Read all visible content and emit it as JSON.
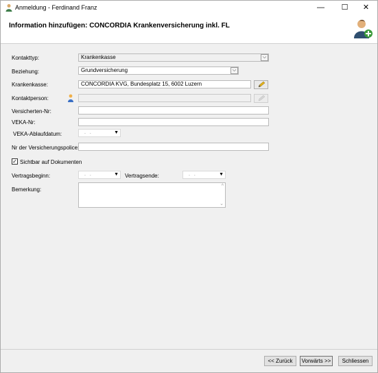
{
  "window": {
    "title": "Anmeldung - Ferdinand Franz",
    "minimize": "—",
    "maximize": "☐",
    "close": "✕"
  },
  "header": {
    "title": "Information hinzufügen: CONCORDIA Krankenversicherung inkl. FL"
  },
  "form": {
    "kontakttyp_label": "Kontakttyp:",
    "kontakttyp_value": "Krankenkasse",
    "beziehung_label": "Beziehung:",
    "beziehung_value": "Grundversicherung",
    "krankenkasse_label": "Krankenkasse:",
    "krankenkasse_value": "CONCORDIA KVG, Bundesplatz 15, 6002 Luzern",
    "kontaktperson_label": "Kontaktperson:",
    "kontaktperson_value": "",
    "versicherten_nr_label": "Versicherten-Nr:",
    "versicherten_nr_value": "",
    "veka_nr_label": "VEKA-Nr:",
    "veka_nr_value": "",
    "veka_ablauf_label": "VEKA-Ablaufdatum:",
    "date_placeholder": ". .",
    "police_label": "Nr der Versicherungspolice:",
    "police_value": "",
    "sichtbar_label": "Sichtbar auf Dokumenten",
    "sichtbar_checked": "✓",
    "vertragsbeginn_label": "Vertragsbeginn:",
    "vertragsende_label": "Vertragsende:",
    "bemerkung_label": "Bemerkung:",
    "bemerkung_value": ""
  },
  "footer": {
    "back_label": "<< Zurück",
    "next_label": "Vorwärts >>",
    "close_label": "Schliessen"
  },
  "icons": {
    "combo_arrow": "⌵",
    "dropdown_arrow": "▼",
    "scroll_up": "^",
    "scroll_down": "⌄"
  }
}
